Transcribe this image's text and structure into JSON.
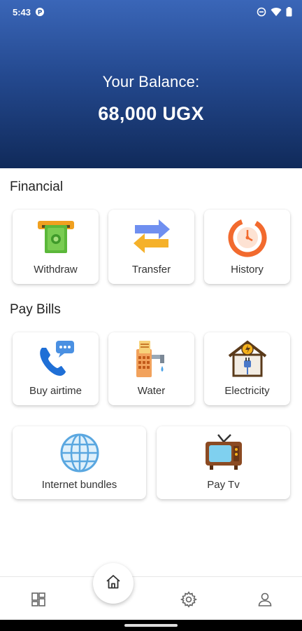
{
  "status_bar": {
    "time": "5:43"
  },
  "balance": {
    "label": "Your Balance:",
    "amount": "68,000 UGX"
  },
  "financial": {
    "title": "Financial",
    "items": [
      {
        "label": "Withdraw",
        "icon": "cash-withdraw-icon"
      },
      {
        "label": "Transfer",
        "icon": "transfer-arrows-icon"
      },
      {
        "label": "History",
        "icon": "history-clock-icon"
      }
    ]
  },
  "pay_bills": {
    "title": "Pay Bills",
    "items": [
      {
        "label": "Buy airtime",
        "icon": "phone-chat-icon"
      },
      {
        "label": "Water",
        "icon": "water-meter-icon"
      },
      {
        "label": "Electricity",
        "icon": "house-plug-icon"
      },
      {
        "label": "Internet bundles",
        "icon": "globe-icon"
      },
      {
        "label": "Pay Tv",
        "icon": "tv-icon"
      }
    ]
  },
  "bottom_nav": {
    "items": [
      "dashboard-icon",
      "home-icon",
      "settings-icon",
      "profile-icon"
    ]
  },
  "colors": {
    "header_top": "#3a66b8",
    "header_bottom": "#102a5a",
    "card_bg": "#ffffff"
  }
}
